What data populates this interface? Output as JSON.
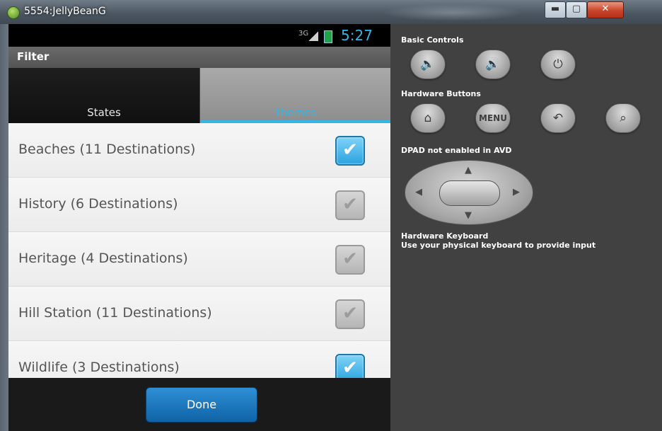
{
  "window": {
    "title": "5554:JellyBeanG",
    "minimize_glyph": "▬",
    "maximize_glyph": "▢",
    "close_glyph": "✕"
  },
  "statusbar": {
    "network": "3G",
    "time": "5:27"
  },
  "actionbar": {
    "title": "Filter"
  },
  "tabs": [
    {
      "label": "States",
      "selected": false
    },
    {
      "label": "Themes",
      "selected": true
    }
  ],
  "list": [
    {
      "label": "Beaches (11 Destinations)",
      "checked": true
    },
    {
      "label": "History (6 Destinations)",
      "checked": false
    },
    {
      "label": "Heritage (4 Destinations)",
      "checked": false
    },
    {
      "label": "Hill Station (11 Destinations)",
      "checked": false
    },
    {
      "label": "Wildlife (3 Destinations)",
      "checked": true
    }
  ],
  "checkmark_glyph": "✔",
  "done_button": "Done",
  "panel": {
    "basic_controls": "Basic Controls",
    "hardware_buttons": "Hardware Buttons",
    "dpad_label_bold": "DPAD",
    "dpad_label_rest": " not enabled in AVD",
    "keyboard_title": "Hardware Keyboard",
    "keyboard_hint": "Use your physical keyboard to provide input",
    "buttons": {
      "volume_down": "🔈",
      "volume_up": "🔊",
      "power": "⏻",
      "home": "⌂",
      "menu": "MENU",
      "back": "↶",
      "search": "⌕"
    },
    "dpad_arrows": {
      "up": "▲",
      "down": "▼",
      "left": "◀",
      "right": "▶"
    }
  },
  "colors": {
    "accent": "#33b5e5",
    "checked": "#2aa3e0",
    "done": "#0f63a6"
  }
}
